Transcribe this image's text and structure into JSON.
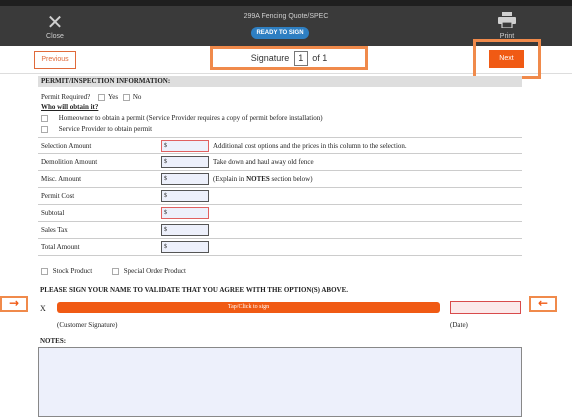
{
  "header": {
    "close_label": "Close",
    "doc_title": "299A Fencing Quote/SPEC",
    "status_badge": "READY TO SIGN",
    "print_label": "Print"
  },
  "nav": {
    "previous_label": "Previous",
    "signature_label": "Signature",
    "current_page": "1",
    "of_label": "of 1",
    "next_label": "Next"
  },
  "form": {
    "section_title": "PERMIT/INSPECTION INFORMATION:",
    "permit_required_label": "Permit Required?",
    "yes_label": "Yes",
    "no_label": "No",
    "who_label": "Who will obtain it?",
    "option_homeowner": "Homeowner to obtain a permit (Service Provider requires a copy of permit before installation)",
    "option_provider": "Service Provider to obtain permit",
    "rows": [
      {
        "label": "Selection Amount",
        "value": "$",
        "note": "Additional cost options and the prices in this column to the selection."
      },
      {
        "label": "Demolition Amount",
        "value": "$",
        "note": "Take down and haul away old fence"
      },
      {
        "label": "Misc. Amount",
        "value": "$",
        "note_pre": "(Explain in ",
        "note_bold": "NOTES",
        "note_post": " section below)"
      },
      {
        "label": "Permit Cost",
        "value": "$",
        "note": ""
      },
      {
        "label": "Subtotal",
        "value": "$",
        "note": ""
      },
      {
        "label": "Sales Tax",
        "value": "$",
        "note": ""
      },
      {
        "label": "Total Amount",
        "value": "$",
        "note": ""
      }
    ],
    "stock_product_label": "Stock Product",
    "special_order_label": "Special Order Product",
    "sign_instruction": "PLEASE SIGN YOUR NAME TO VALIDATE THAT YOU AGREE WITH THE OPTION(S) ABOVE.",
    "x_mark": "X",
    "tap_to_sign": "Tap/Click to sign",
    "customer_signature_label": "(Customer Signature)",
    "date_label": "(Date)",
    "notes_label": "NOTES:",
    "notes_value": ""
  },
  "icons": {
    "close": "close-icon",
    "print": "printer-icon",
    "left_pointer": "arrow-right-icon",
    "right_pointer": "arrow-left-icon"
  },
  "colors": {
    "accent": "#f05a14",
    "badge": "#2e7fc2",
    "topbar": "#3a3a3a",
    "highlight_outline": "#f08a4b"
  }
}
